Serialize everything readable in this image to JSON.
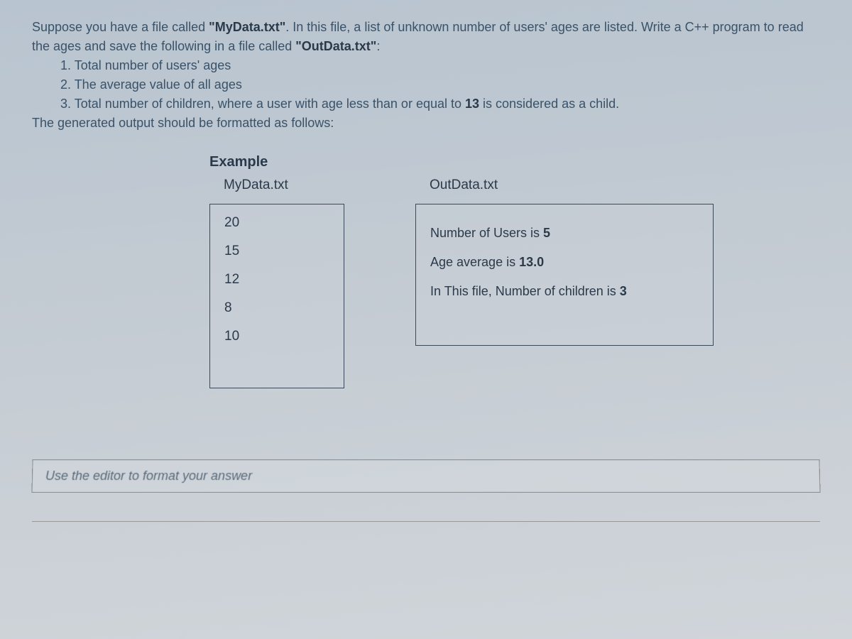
{
  "question": {
    "intro_part1": "Suppose you have a file called ",
    "file_in": "\"MyData.txt\"",
    "intro_part2": ". In this file, a list of unknown number of users' ages are listed. Write a C++ program to read the ages and save the following in a file called ",
    "file_out": "\"OutData.txt\"",
    "intro_part3": ":",
    "item1": "1. Total number of users' ages",
    "item2": "2. The average value of all ages",
    "item3_part1": "3. Total number of children, where a user with age less than or equal to ",
    "item3_bold": "13",
    "item3_part2": " is considered as a child.",
    "outro": "The generated output should be formatted as follows:"
  },
  "example": {
    "title": "Example",
    "mydata_label": "MyData.txt",
    "outdata_label": "OutData.txt",
    "mydata_values": [
      "20",
      "15",
      "12",
      "8",
      "10"
    ],
    "outdata": {
      "line1_text": "Number of Users is ",
      "line1_val": "5",
      "line2_text": "Age average is ",
      "line2_val": "13.0",
      "line3_text": "In This file, Number of children is ",
      "line3_val": "3"
    }
  },
  "editor_placeholder": "Use the editor to format your answer"
}
